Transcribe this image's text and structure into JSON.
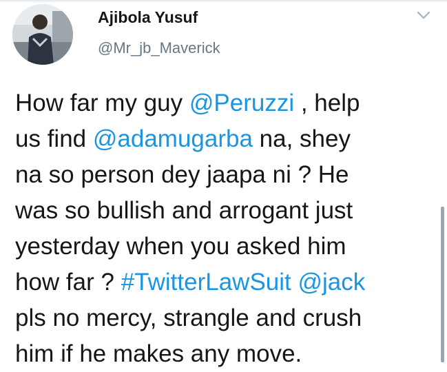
{
  "tweet": {
    "display_name": "Ajibola Yusuf",
    "handle": "@Mr_jb_Maverick",
    "menu_icon": "chevron-down-icon",
    "avatar_icon": "profile-photo",
    "link_color": "#1b95e0",
    "text_lines": [
      [
        {
          "text": "How far my guy ",
          "link": false
        },
        {
          "text": "@Peruzzi",
          "link": true
        },
        {
          "text": " , help",
          "link": false
        }
      ],
      [
        {
          "text": "us find ",
          "link": false
        },
        {
          "text": "@adamugarba",
          "link": true
        },
        {
          "text": " na, shey",
          "link": false
        }
      ],
      [
        {
          "text": "na so person dey jaapa ni ? He",
          "link": false
        }
      ],
      [
        {
          "text": "was so bullish and arrogant just",
          "link": false
        }
      ],
      [
        {
          "text": "yesterday when you asked him",
          "link": false
        }
      ],
      [
        {
          "text": "how far ? ",
          "link": false
        },
        {
          "text": "#TwitterLawSuit",
          "link": true
        },
        {
          "text": " ",
          "link": false
        },
        {
          "text": "@jack",
          "link": true
        }
      ],
      [
        {
          "text": "pls no mercy, strangle and crush",
          "link": false
        }
      ],
      [
        {
          "text": "him if he makes any move.",
          "link": false
        }
      ]
    ]
  }
}
